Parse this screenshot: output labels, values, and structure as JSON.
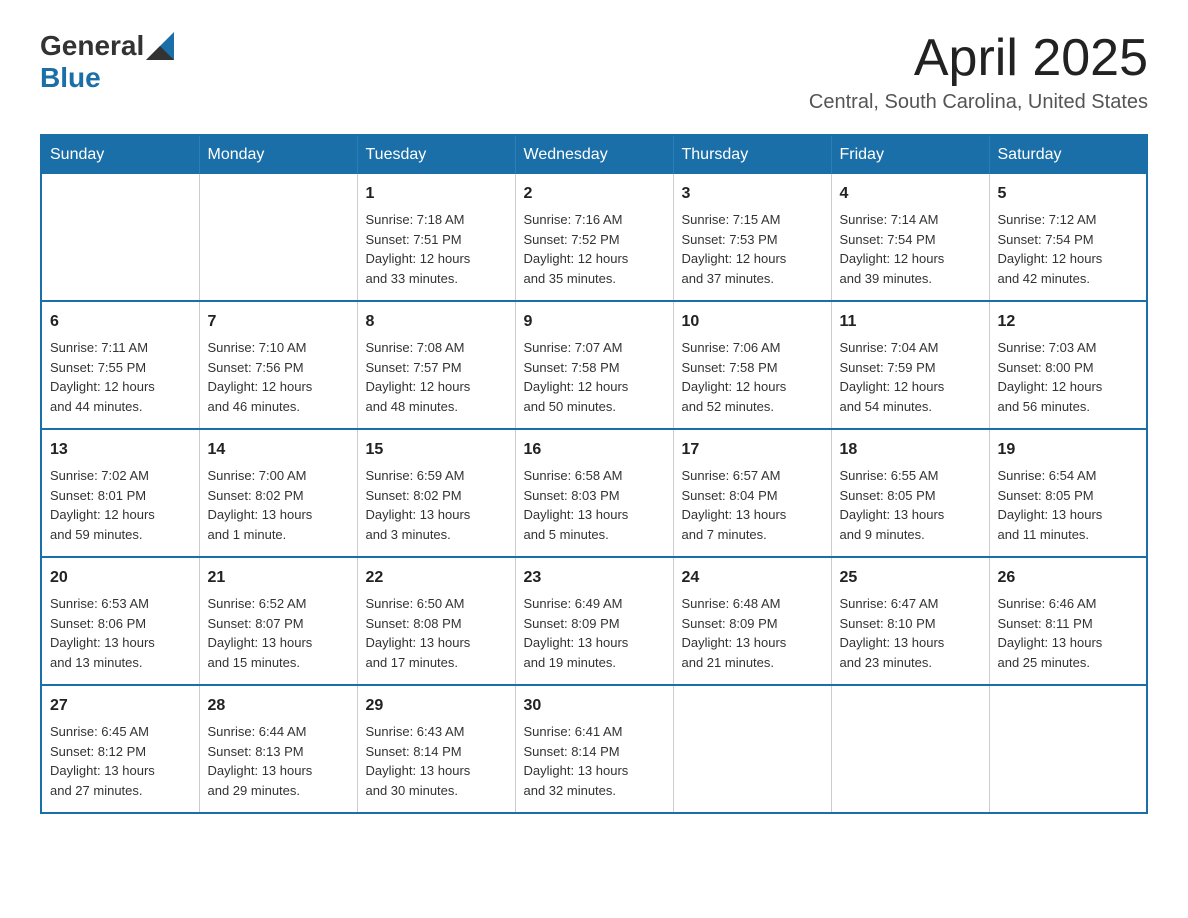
{
  "header": {
    "logo_general": "General",
    "logo_blue": "Blue",
    "month_year": "April 2025",
    "location": "Central, South Carolina, United States"
  },
  "days_of_week": [
    "Sunday",
    "Monday",
    "Tuesday",
    "Wednesday",
    "Thursday",
    "Friday",
    "Saturday"
  ],
  "weeks": [
    [
      {
        "day": "",
        "info": ""
      },
      {
        "day": "",
        "info": ""
      },
      {
        "day": "1",
        "info": "Sunrise: 7:18 AM\nSunset: 7:51 PM\nDaylight: 12 hours\nand 33 minutes."
      },
      {
        "day": "2",
        "info": "Sunrise: 7:16 AM\nSunset: 7:52 PM\nDaylight: 12 hours\nand 35 minutes."
      },
      {
        "day": "3",
        "info": "Sunrise: 7:15 AM\nSunset: 7:53 PM\nDaylight: 12 hours\nand 37 minutes."
      },
      {
        "day": "4",
        "info": "Sunrise: 7:14 AM\nSunset: 7:54 PM\nDaylight: 12 hours\nand 39 minutes."
      },
      {
        "day": "5",
        "info": "Sunrise: 7:12 AM\nSunset: 7:54 PM\nDaylight: 12 hours\nand 42 minutes."
      }
    ],
    [
      {
        "day": "6",
        "info": "Sunrise: 7:11 AM\nSunset: 7:55 PM\nDaylight: 12 hours\nand 44 minutes."
      },
      {
        "day": "7",
        "info": "Sunrise: 7:10 AM\nSunset: 7:56 PM\nDaylight: 12 hours\nand 46 minutes."
      },
      {
        "day": "8",
        "info": "Sunrise: 7:08 AM\nSunset: 7:57 PM\nDaylight: 12 hours\nand 48 minutes."
      },
      {
        "day": "9",
        "info": "Sunrise: 7:07 AM\nSunset: 7:58 PM\nDaylight: 12 hours\nand 50 minutes."
      },
      {
        "day": "10",
        "info": "Sunrise: 7:06 AM\nSunset: 7:58 PM\nDaylight: 12 hours\nand 52 minutes."
      },
      {
        "day": "11",
        "info": "Sunrise: 7:04 AM\nSunset: 7:59 PM\nDaylight: 12 hours\nand 54 minutes."
      },
      {
        "day": "12",
        "info": "Sunrise: 7:03 AM\nSunset: 8:00 PM\nDaylight: 12 hours\nand 56 minutes."
      }
    ],
    [
      {
        "day": "13",
        "info": "Sunrise: 7:02 AM\nSunset: 8:01 PM\nDaylight: 12 hours\nand 59 minutes."
      },
      {
        "day": "14",
        "info": "Sunrise: 7:00 AM\nSunset: 8:02 PM\nDaylight: 13 hours\nand 1 minute."
      },
      {
        "day": "15",
        "info": "Sunrise: 6:59 AM\nSunset: 8:02 PM\nDaylight: 13 hours\nand 3 minutes."
      },
      {
        "day": "16",
        "info": "Sunrise: 6:58 AM\nSunset: 8:03 PM\nDaylight: 13 hours\nand 5 minutes."
      },
      {
        "day": "17",
        "info": "Sunrise: 6:57 AM\nSunset: 8:04 PM\nDaylight: 13 hours\nand 7 minutes."
      },
      {
        "day": "18",
        "info": "Sunrise: 6:55 AM\nSunset: 8:05 PM\nDaylight: 13 hours\nand 9 minutes."
      },
      {
        "day": "19",
        "info": "Sunrise: 6:54 AM\nSunset: 8:05 PM\nDaylight: 13 hours\nand 11 minutes."
      }
    ],
    [
      {
        "day": "20",
        "info": "Sunrise: 6:53 AM\nSunset: 8:06 PM\nDaylight: 13 hours\nand 13 minutes."
      },
      {
        "day": "21",
        "info": "Sunrise: 6:52 AM\nSunset: 8:07 PM\nDaylight: 13 hours\nand 15 minutes."
      },
      {
        "day": "22",
        "info": "Sunrise: 6:50 AM\nSunset: 8:08 PM\nDaylight: 13 hours\nand 17 minutes."
      },
      {
        "day": "23",
        "info": "Sunrise: 6:49 AM\nSunset: 8:09 PM\nDaylight: 13 hours\nand 19 minutes."
      },
      {
        "day": "24",
        "info": "Sunrise: 6:48 AM\nSunset: 8:09 PM\nDaylight: 13 hours\nand 21 minutes."
      },
      {
        "day": "25",
        "info": "Sunrise: 6:47 AM\nSunset: 8:10 PM\nDaylight: 13 hours\nand 23 minutes."
      },
      {
        "day": "26",
        "info": "Sunrise: 6:46 AM\nSunset: 8:11 PM\nDaylight: 13 hours\nand 25 minutes."
      }
    ],
    [
      {
        "day": "27",
        "info": "Sunrise: 6:45 AM\nSunset: 8:12 PM\nDaylight: 13 hours\nand 27 minutes."
      },
      {
        "day": "28",
        "info": "Sunrise: 6:44 AM\nSunset: 8:13 PM\nDaylight: 13 hours\nand 29 minutes."
      },
      {
        "day": "29",
        "info": "Sunrise: 6:43 AM\nSunset: 8:14 PM\nDaylight: 13 hours\nand 30 minutes."
      },
      {
        "day": "30",
        "info": "Sunrise: 6:41 AM\nSunset: 8:14 PM\nDaylight: 13 hours\nand 32 minutes."
      },
      {
        "day": "",
        "info": ""
      },
      {
        "day": "",
        "info": ""
      },
      {
        "day": "",
        "info": ""
      }
    ]
  ]
}
